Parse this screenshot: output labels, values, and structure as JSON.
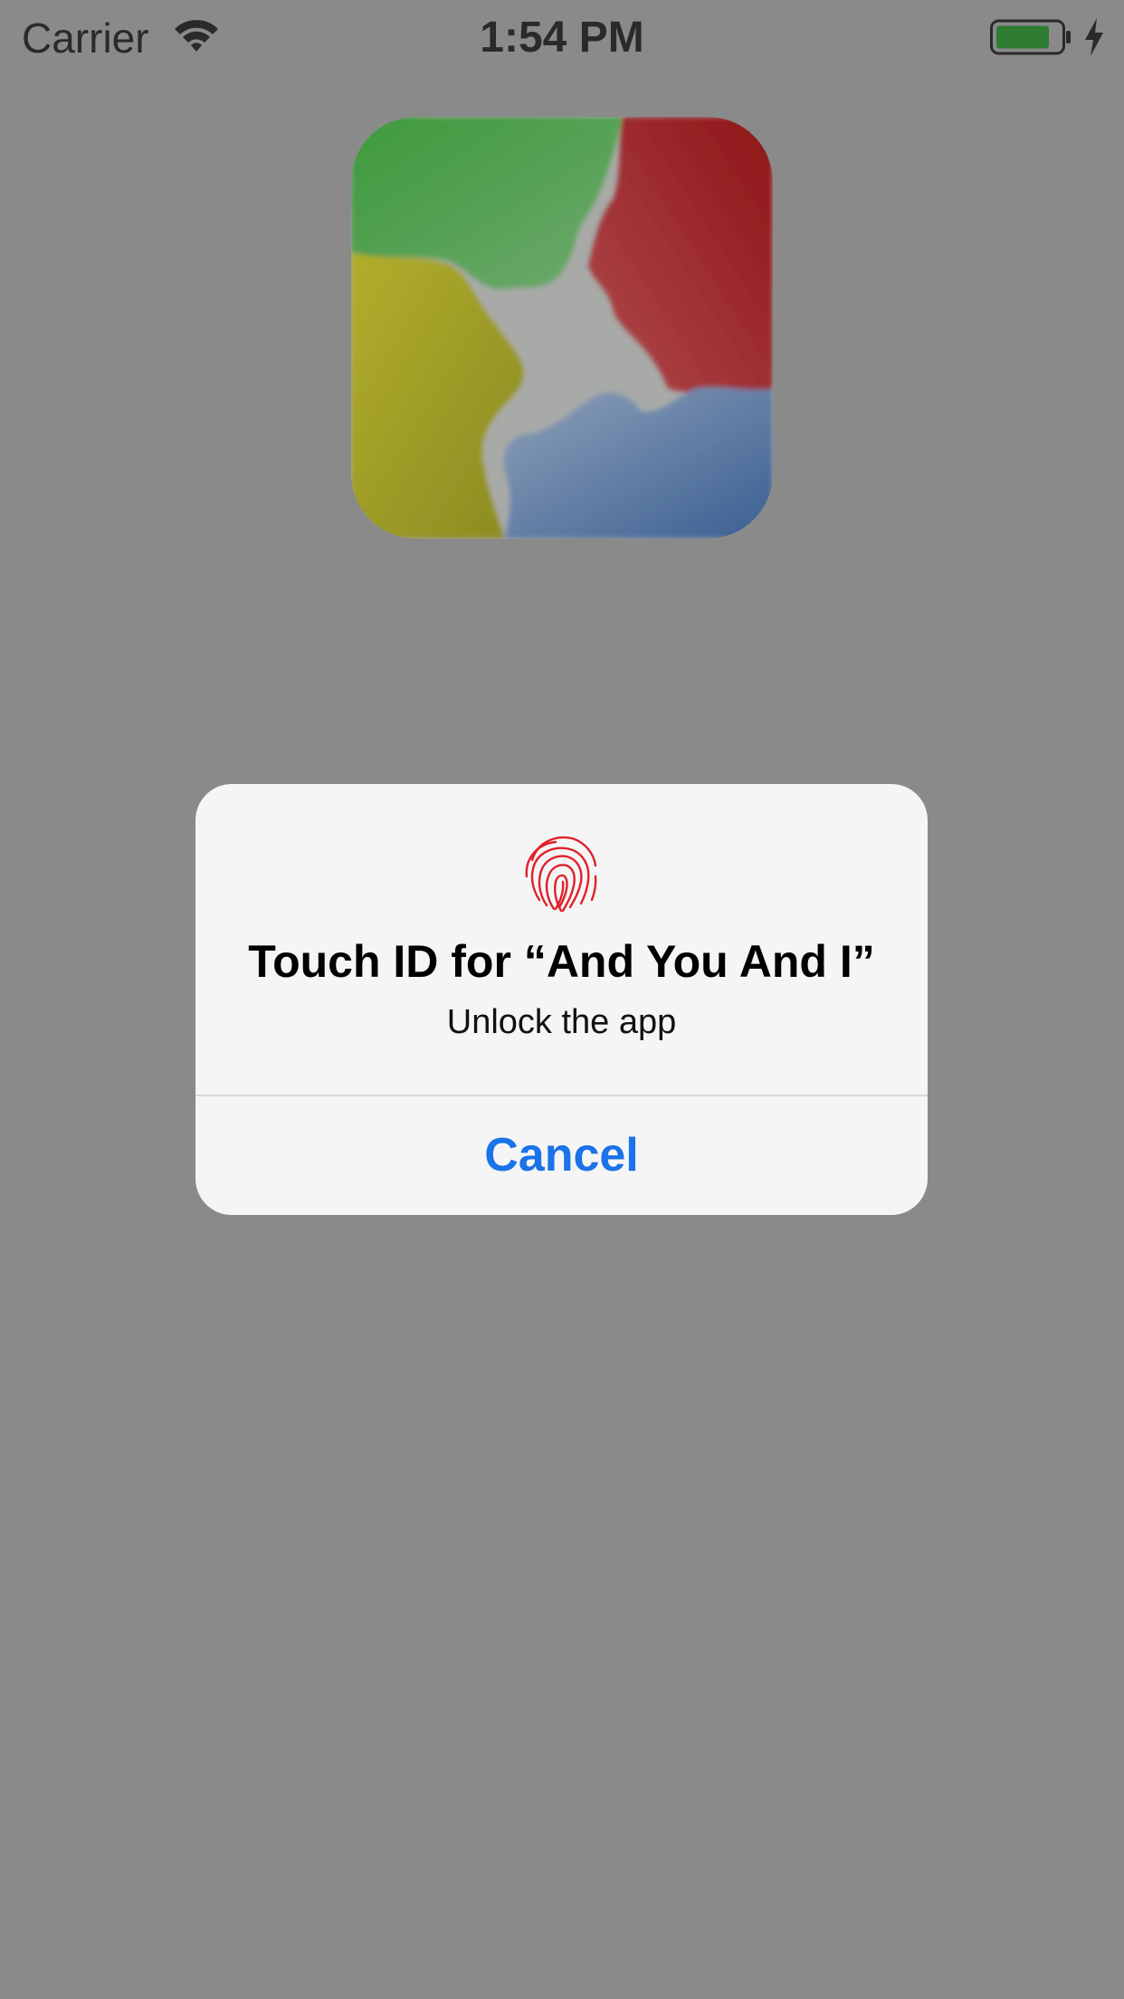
{
  "status_bar": {
    "carrier": "Carrier",
    "time": "1:54 PM",
    "wifi_icon": "wifi-icon",
    "battery_icon": "battery-charging-icon",
    "battery_color": "#2e7d32"
  },
  "app": {
    "logo_icon": "app-logo-four-faces",
    "logo_colors": [
      "#3c9a3c",
      "#b8252a",
      "#b3b02a",
      "#3f6ea8"
    ]
  },
  "touch_id_dialog": {
    "icon": "fingerprint-icon",
    "icon_color": "#e0202a",
    "title": "Touch ID for “And You And I”",
    "subtitle": "Unlock the app",
    "cancel_label": "Cancel",
    "cancel_color": "#1a73e8"
  },
  "colors": {
    "dimmed_background": "#8a8a8a",
    "dialog_background": "#f5f5f5"
  }
}
